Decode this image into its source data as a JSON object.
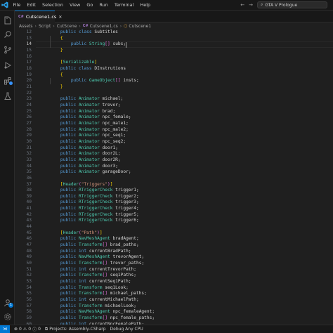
{
  "title_bar": {
    "menu": [
      "File",
      "Edit",
      "Selection",
      "View",
      "Go",
      "Run",
      "Terminal",
      "Help"
    ],
    "search_text": "GTA V Prologue"
  },
  "activity_bar": {
    "icons": [
      "explorer-icon",
      "search-icon",
      "source-control-icon",
      "run-debug-icon",
      "extensions-icon",
      "testing-icon",
      "account-icon",
      "settings-icon"
    ],
    "account_badge": "1"
  },
  "tab": {
    "label": "Cutscene1.cs",
    "lang_icon": "C#"
  },
  "breadcrumb": [
    "Assets",
    "Script",
    "CutScene",
    "Cutscene1.cs",
    "Cutscene1"
  ],
  "editor": {
    "active_line": "14",
    "lines": [
      {
        "n": "12",
        "t": "    public class Subtitles"
      },
      {
        "n": "13",
        "t": "    {"
      },
      {
        "n": "14",
        "t": "        public String[] subs;"
      },
      {
        "n": "15",
        "t": "    }"
      },
      {
        "n": "16",
        "t": ""
      },
      {
        "n": "17",
        "t": "    [Serializable]"
      },
      {
        "n": "18",
        "t": "    public class DInstrutions"
      },
      {
        "n": "19",
        "t": "    {"
      },
      {
        "n": "20",
        "t": "        public GameObject[] insts;"
      },
      {
        "n": "21",
        "t": "    }"
      },
      {
        "n": "22",
        "t": ""
      },
      {
        "n": "23",
        "t": "    public Animator michael;"
      },
      {
        "n": "24",
        "t": "    public Animator trevor;"
      },
      {
        "n": "25",
        "t": "    public Animator brad;"
      },
      {
        "n": "26",
        "t": "    public Animator npc_female;"
      },
      {
        "n": "27",
        "t": "    public Animator npc_male1;"
      },
      {
        "n": "28",
        "t": "    public Animator npc_male2;"
      },
      {
        "n": "29",
        "t": "    public Animator npc_seq1;"
      },
      {
        "n": "30",
        "t": "    public Animator npc_seq2;"
      },
      {
        "n": "31",
        "t": "    public Animator door1;"
      },
      {
        "n": "32",
        "t": "    public Animator door2L;"
      },
      {
        "n": "33",
        "t": "    public Animator door2R;"
      },
      {
        "n": "34",
        "t": "    public Animator door3;"
      },
      {
        "n": "35",
        "t": "    public Animator garageDoor;"
      },
      {
        "n": "36",
        "t": ""
      },
      {
        "n": "37",
        "t": "    [Header(\"Triggers\")]"
      },
      {
        "n": "38",
        "t": "    public RTriggerCheck trigger1;"
      },
      {
        "n": "39",
        "t": "    public RTriggerCheck trigger2;"
      },
      {
        "n": "40",
        "t": "    public RTriggerCheck trigger3;"
      },
      {
        "n": "41",
        "t": "    public RTriggerCheck trigger4;"
      },
      {
        "n": "42",
        "t": "    public RTriggerCheck trigger5;"
      },
      {
        "n": "43",
        "t": "    public RTriggerCheck trigger6;"
      },
      {
        "n": "44",
        "t": ""
      },
      {
        "n": "45",
        "t": "    [Header(\"Path\")]"
      },
      {
        "n": "46",
        "t": "    public NavMeshAgent bradAgent;"
      },
      {
        "n": "47",
        "t": "    public Transform[] brad_paths;"
      },
      {
        "n": "48",
        "t": "    public int currentBradPath;"
      },
      {
        "n": "49",
        "t": "    public NavMeshAgent trevorAgent;"
      },
      {
        "n": "50",
        "t": "    public Transform[] trevor_paths;"
      },
      {
        "n": "51",
        "t": "    public int currentTrevorPath;"
      },
      {
        "n": "52",
        "t": "    public Transform[] seq1Paths;"
      },
      {
        "n": "53",
        "t": "    public int currentSeq1Path;"
      },
      {
        "n": "54",
        "t": "    public Transform seq1Look;"
      },
      {
        "n": "55",
        "t": "    public Transform[] michael_paths;"
      },
      {
        "n": "56",
        "t": "    public int currentMichaelPath;"
      },
      {
        "n": "57",
        "t": "    public Transform michaelLook;"
      },
      {
        "n": "58",
        "t": "    public NavMeshAgent npc_femaleAgent;"
      },
      {
        "n": "59",
        "t": "    public Transform[] npc_female_paths;"
      },
      {
        "n": "60",
        "t": "    public int currentNpcFemalePath;"
      }
    ]
  },
  "status_bar": {
    "errors": "0",
    "warnings": "0",
    "info": "0",
    "projects": "Projects: Assembly-CSharp",
    "debug": "Debug Any CPU"
  },
  "colors": {
    "accent": "#0078d4",
    "keyword": "#569cd6",
    "type": "#4ec9b0",
    "string": "#ce9178",
    "editor_bg": "#1f1f1f"
  }
}
